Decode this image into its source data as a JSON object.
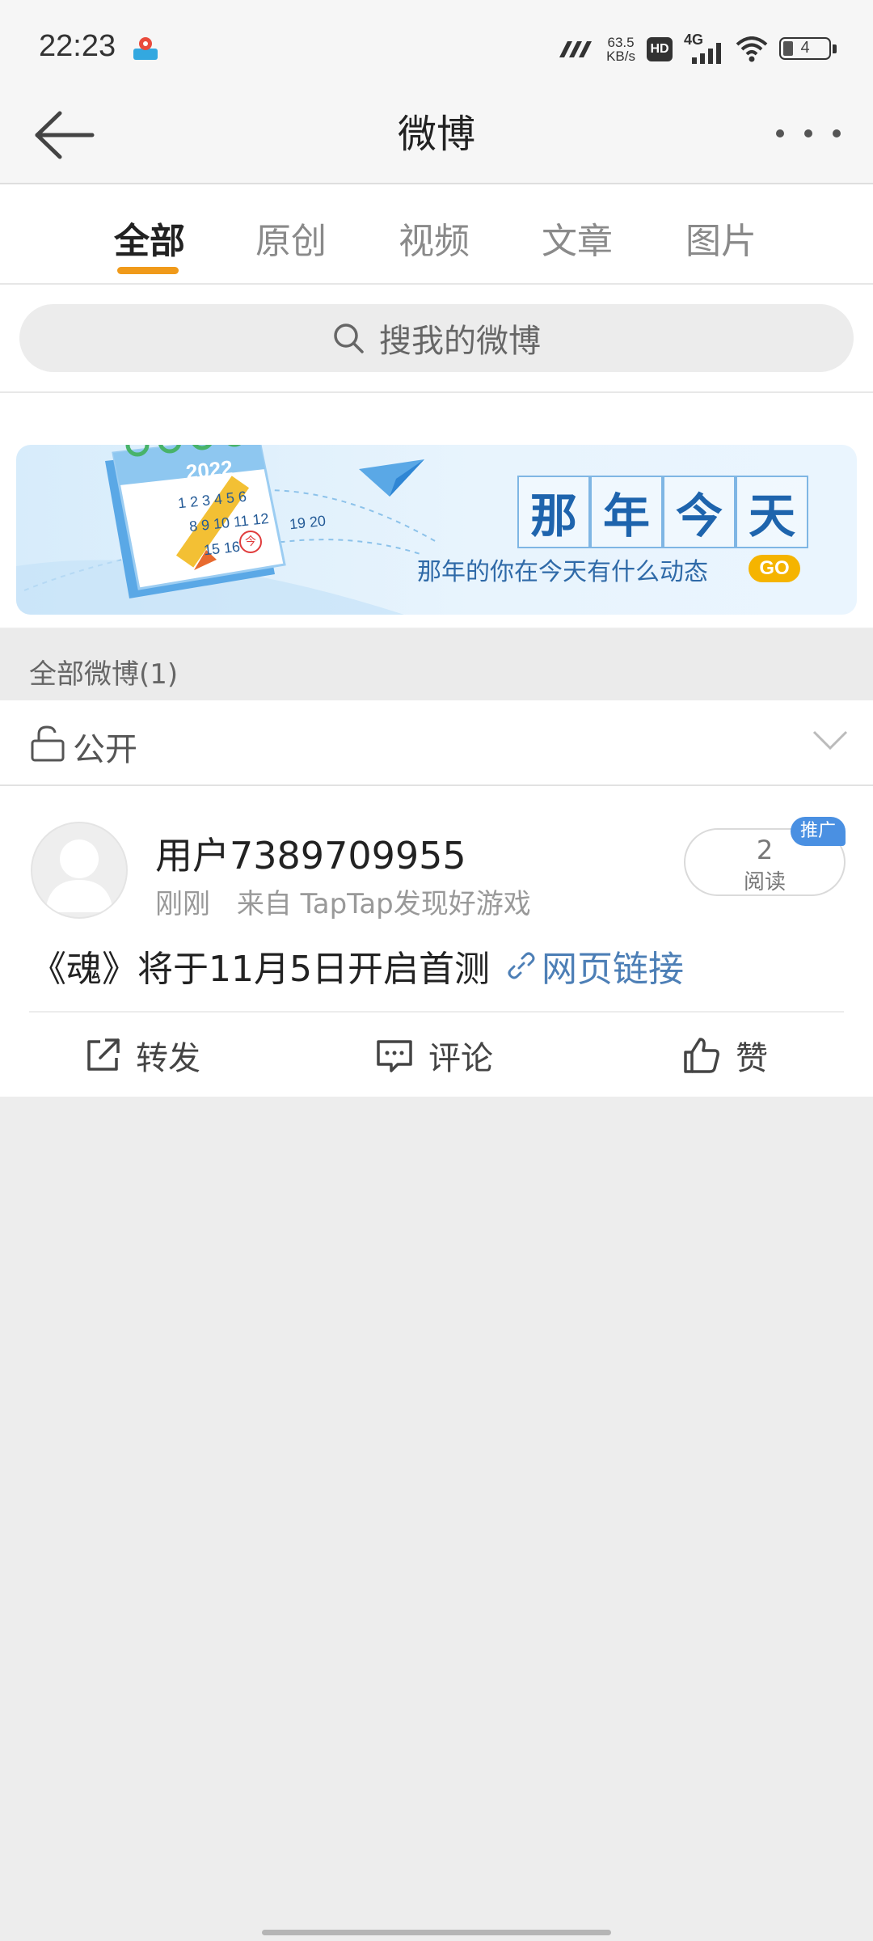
{
  "status_bar": {
    "time": "22:23",
    "net_speed_value": "63.5",
    "net_speed_unit": "KB/s",
    "hd_badge": "HD",
    "network_type": "4G",
    "battery_level": "4"
  },
  "nav": {
    "title": "微博"
  },
  "tabs": [
    {
      "label": "全部",
      "active": true
    },
    {
      "label": "原创",
      "active": false
    },
    {
      "label": "视频",
      "active": false
    },
    {
      "label": "文章",
      "active": false
    },
    {
      "label": "图片",
      "active": false
    }
  ],
  "search": {
    "placeholder": "搜我的微博"
  },
  "banner": {
    "calendar_year": "2022",
    "calendar_dates": [
      "1 2 3 4 5 6",
      "8 9 10 11 12",
      "15 16",
      "19 20"
    ],
    "calendar_today": "今",
    "title_chars": [
      "那",
      "年",
      "今",
      "天"
    ],
    "subtitle": "那年的你在今天有什么动态",
    "go_label": "GO"
  },
  "section": {
    "title": "全部微博(1)"
  },
  "filter": {
    "label": "公开"
  },
  "post": {
    "username": "用户7389709955",
    "time": "刚刚",
    "source": "来自 TapTap发现好游戏",
    "read_count": "2",
    "read_label": "阅读",
    "promo_badge": "推广",
    "text": "《魂》将于11月5日开启首测",
    "link_label": "网页链接",
    "actions": {
      "repost": "转发",
      "comment": "评论",
      "like": "赞"
    }
  },
  "colors": {
    "accent_orange": "#f09a1a",
    "link_blue": "#4d7fb6",
    "promo_blue": "#4a90e2",
    "banner_blue": "#1e64ad"
  }
}
